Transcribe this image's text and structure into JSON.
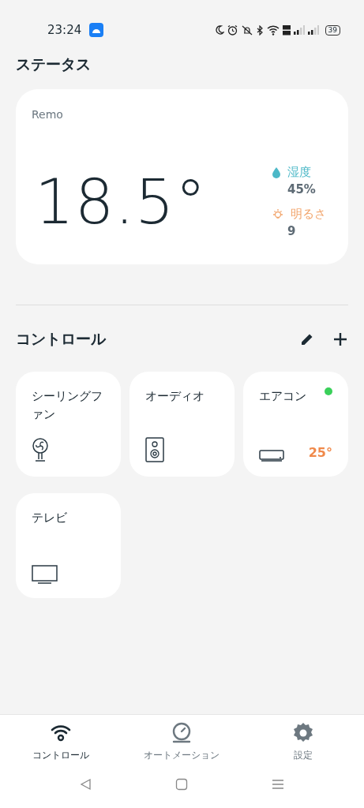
{
  "status_bar": {
    "time": "23:24",
    "battery": "39"
  },
  "status": {
    "title": "ステータス",
    "device": "Remo",
    "temperature": "18.5°",
    "sensors": [
      {
        "kind": "humidity",
        "label": "湿度",
        "value": "45%"
      },
      {
        "kind": "light",
        "label": "明るさ",
        "value": "9"
      }
    ]
  },
  "controls": {
    "title": "コントロール",
    "devices": [
      {
        "kind": "fan",
        "name": "シーリングファン",
        "on": false
      },
      {
        "kind": "speaker",
        "name": "オーディオ",
        "on": false
      },
      {
        "kind": "aircon",
        "name": "エアコン",
        "on": true,
        "reading": "25°"
      },
      {
        "kind": "tv",
        "name": "テレビ",
        "on": false
      }
    ]
  },
  "bottom_nav": [
    {
      "kind": "remote",
      "label": "コントロール",
      "selected": true
    },
    {
      "kind": "automation",
      "label": "オートメーション",
      "selected": false
    },
    {
      "kind": "settings",
      "label": "設定",
      "selected": false
    }
  ]
}
